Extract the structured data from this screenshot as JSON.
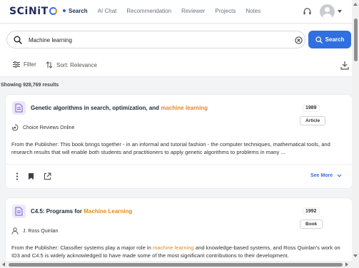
{
  "app": {
    "logo_text": "SCiNiTO",
    "logo_prefix": "SCiNiT"
  },
  "nav": {
    "items": [
      {
        "label": "Search",
        "active": true
      },
      {
        "label": "AI Chat"
      },
      {
        "label": "Recommendation"
      },
      {
        "label": "Reviewer"
      },
      {
        "label": "Projects"
      },
      {
        "label": "Notes"
      }
    ]
  },
  "header_icons": {
    "help": "headset-icon",
    "profile": "avatar-icon"
  },
  "search": {
    "value": "Machine learning",
    "button_label": "Search"
  },
  "toolbar": {
    "filter_label": "Filter",
    "sort_label": "Sort: Relevance"
  },
  "results_count": "Showing 928,769 results",
  "results": [
    {
      "title_prefix": "Genetic algorithms in search, optimization, and ",
      "title_highlight": "machine learning",
      "year": "1989",
      "type": "Article",
      "source": "Choice Reviews Online",
      "abstract": "From the Publisher: This book brings together - in an informal and tutorial fashion - the computer techniques, mathematical tools, and research results that will enable both students and practitioners to apply genetic algorithms to problems in many ...",
      "see_more": "See More"
    },
    {
      "title_prefix": "C4.5: Programs for ",
      "title_highlight": "Machine Learning",
      "year": "1992",
      "type": "Book",
      "author": "J. Ross Quinlan",
      "abstract_before": "From the Publisher: Classifier systems play a major role in ",
      "abstract_highlight": "machine learning",
      "abstract_after": " and knowledge-based systems, and Ross Quinlan's work on ID3 and C4.5 is widely acknowledged to have made some of the most significant contributions to their development."
    }
  ],
  "colors": {
    "accent": "#2f6fe0",
    "highlight": "#e08a1e",
    "brand": "#1f2a5c"
  }
}
